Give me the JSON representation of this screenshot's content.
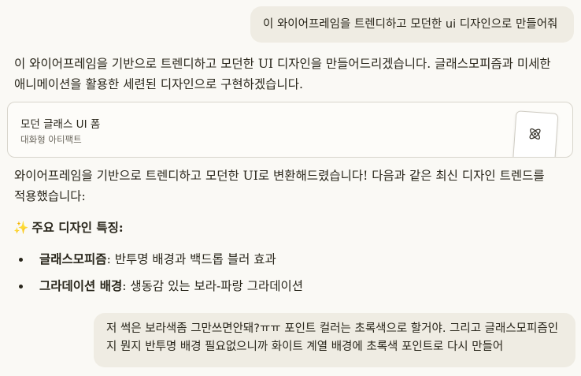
{
  "messages": {
    "user1": "이 와이어프레임을 트렌디하고 모던한 ui 디자인으로 만들어줘",
    "assistant1": "이 와이어프레임을 기반으로 트렌디하고 모던한 UI 디자인을 만들어드리겠습니다. 글래스모피즘과 미세한 애니메이션을 활용한 세련된 디자인으로 구현하겠습니다.",
    "artifact": {
      "title": "모던 글래스 UI 폼",
      "subtitle": "대화형 아티팩트",
      "icon": "atom-icon"
    },
    "assistant2": "와이어프레임을 기반으로 트렌디하고 모던한 UI로 변환해드렸습니다! 다음과 같은 최신 디자인 트렌드를 적용했습니다:",
    "features_heading": "주요 디자인 특징:",
    "features_icon": "sparkles-icon",
    "features": [
      {
        "term": "글래스모피즘",
        "desc": ": 반투명 배경과 백드롭 블러 효과"
      },
      {
        "term": "그라데이션 배경",
        "desc": ": 생동감 있는 보라-파랑 그라데이션"
      }
    ],
    "user2": "저 썩은 보라색좀 그만쓰면안돼?ㅠㅠ 포인트 컬러는 초록색으로 할거야. 그리고 글래스모피즘인지 뭔지 반투명 배경 필요없으니까 화이트 계열 배경에 초록색 포인트로 다시 만들어"
  },
  "colors": {
    "background": "#faf9f5",
    "user_bubble": "#efece3",
    "text": "#29261b"
  }
}
